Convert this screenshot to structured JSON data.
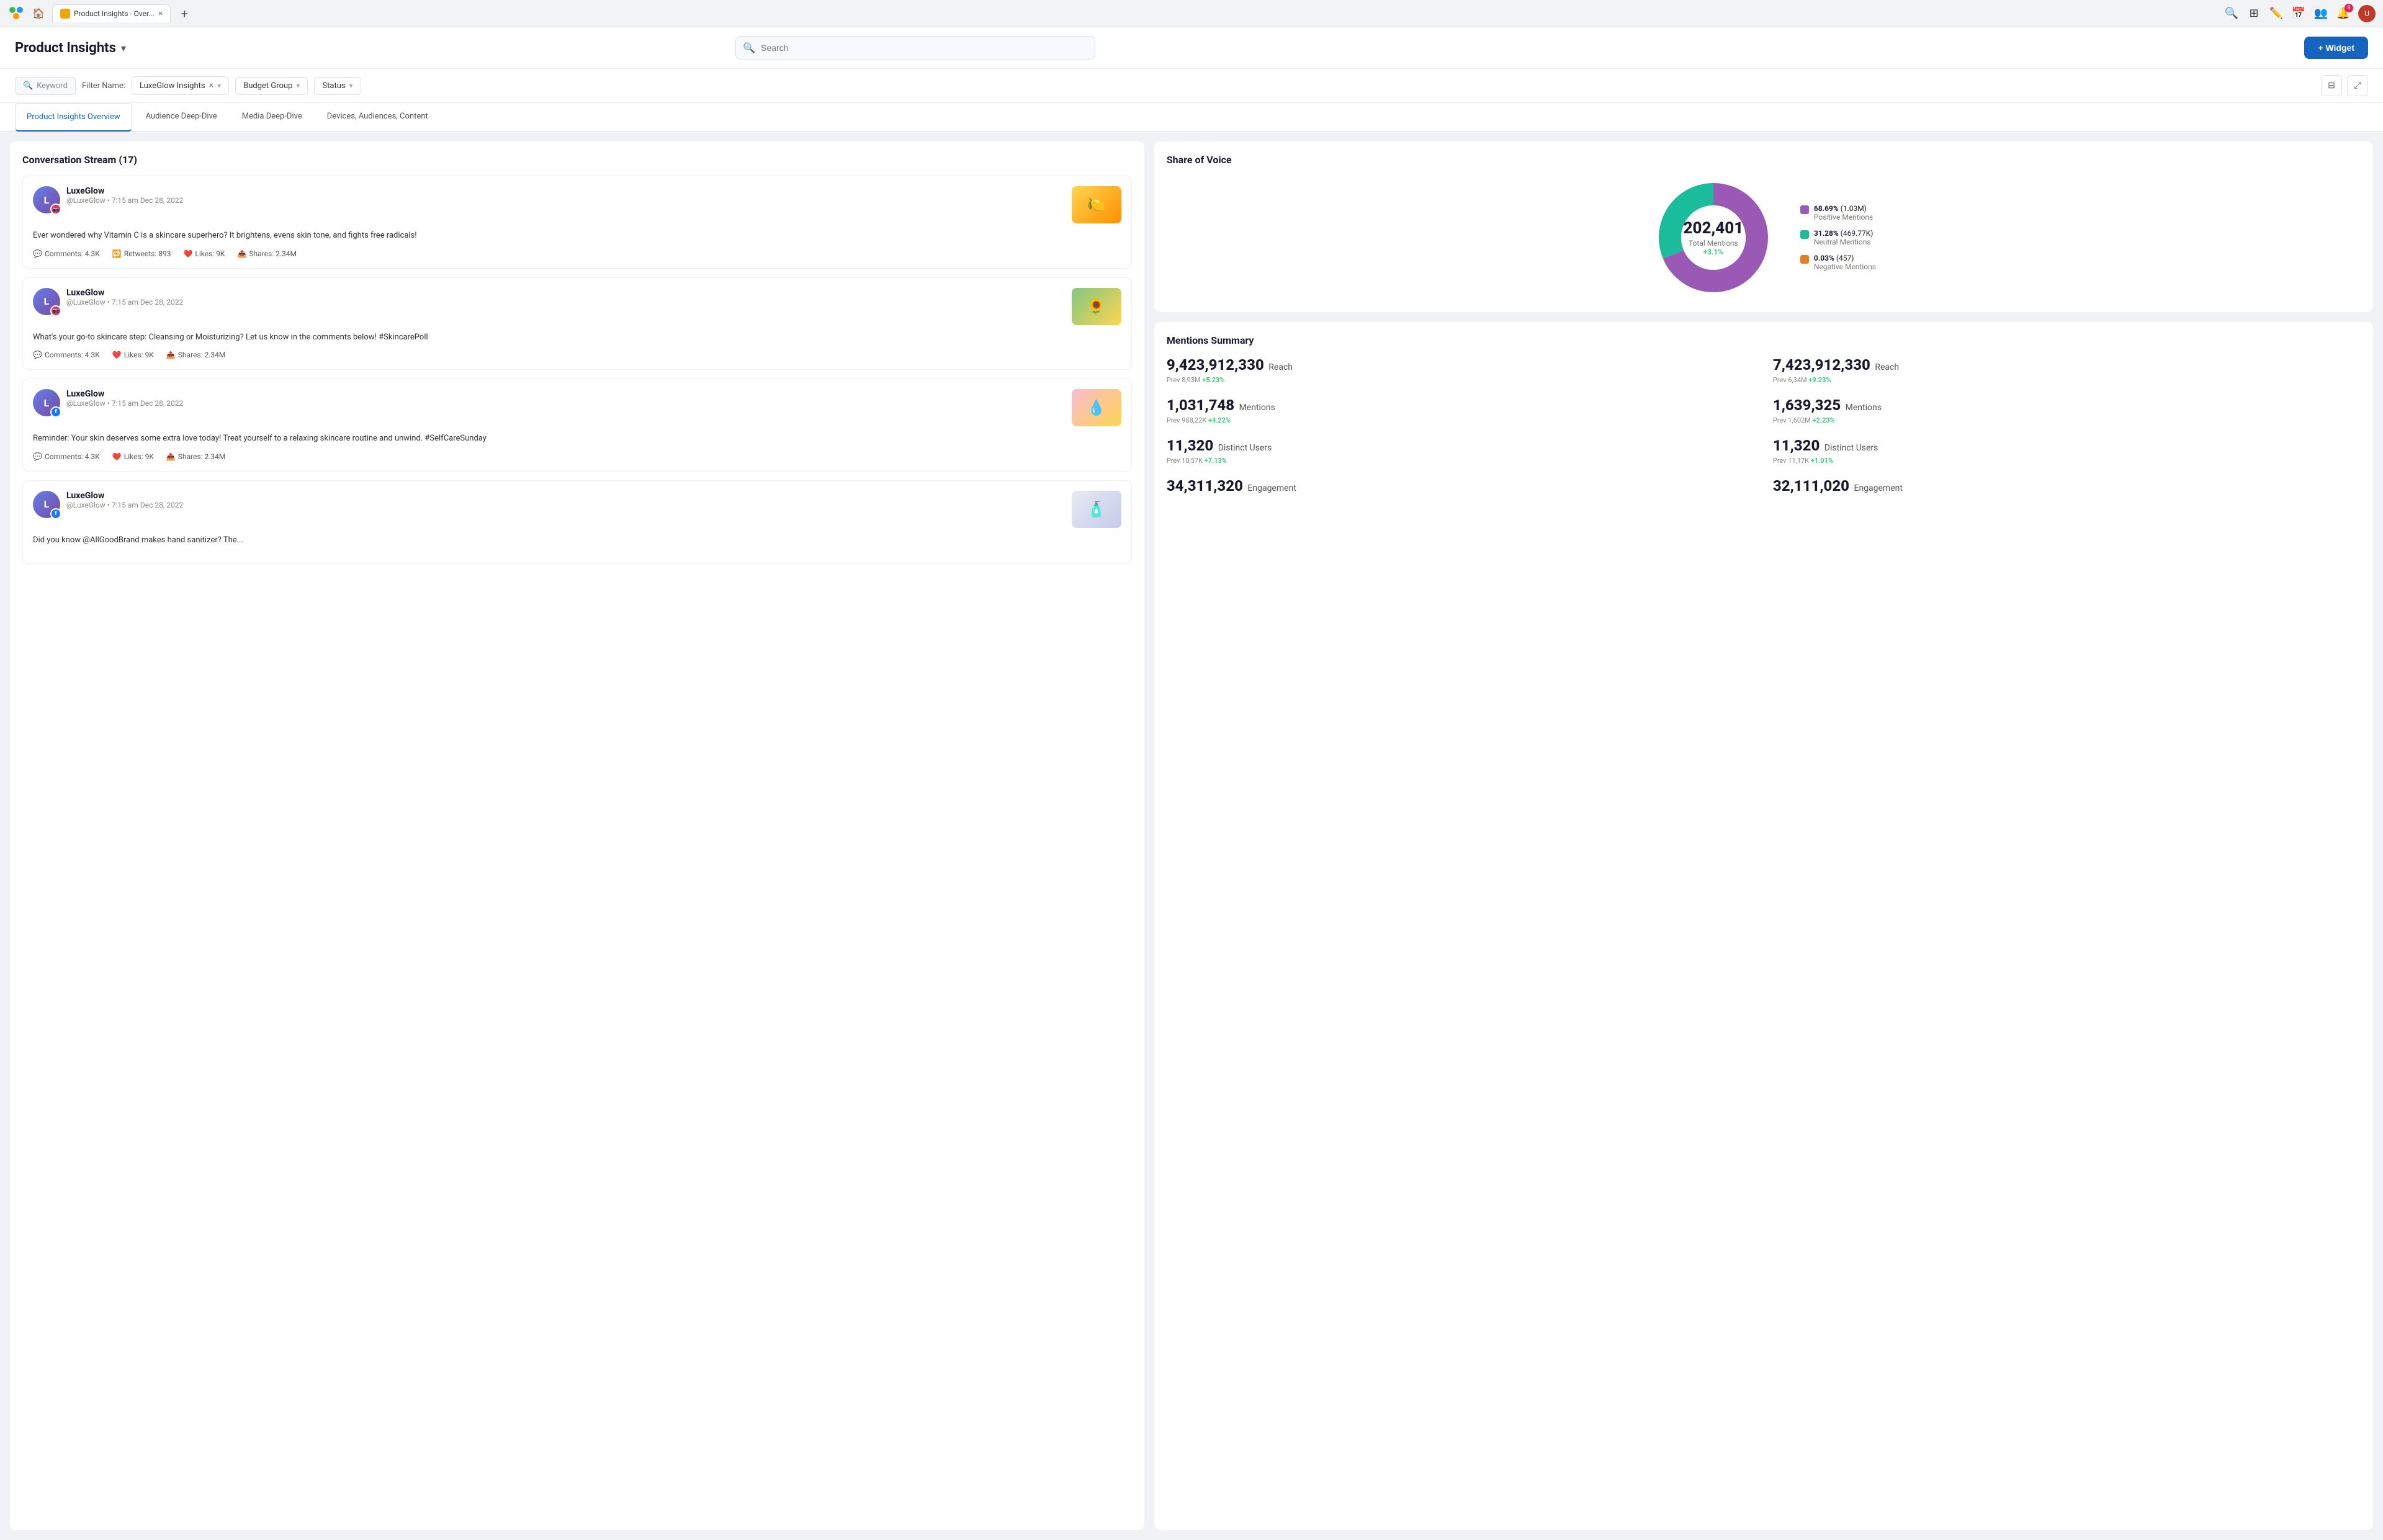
{
  "browser": {
    "tab_title": "Product Insights - Over...",
    "tab_close": "×",
    "tab_add": "+",
    "icons": [
      "search",
      "grid",
      "edit",
      "calendar",
      "users",
      "bell",
      "avatar"
    ],
    "bell_badge": "8",
    "users_badge": ""
  },
  "header": {
    "page_title": "Product Insights",
    "chevron": "▾",
    "search_placeholder": "Search",
    "widget_button": "+ Widget"
  },
  "filter_bar": {
    "keyword_placeholder": "Keyword",
    "filter_name_label": "Filter Name:",
    "filter_tag": "LuxeGlow Insights",
    "filter_tag_close": "×",
    "budget_group_label": "Budget Group",
    "status_label": "Status"
  },
  "tabs": [
    {
      "id": "overview",
      "label": "Product Insights Overview",
      "active": true
    },
    {
      "id": "audience",
      "label": "Audience Deep-Dive",
      "active": false
    },
    {
      "id": "media",
      "label": "Media Deep-Dive",
      "active": false
    },
    {
      "id": "devices",
      "label": "Devices, Audiences, Content",
      "active": false
    }
  ],
  "conversation_stream": {
    "title": "Conversation Stream (17)",
    "posts": [
      {
        "username": "LuxeGlow",
        "handle": "@LuxeGlow",
        "timestamp": "7:15 am Dec 28, 2022",
        "social": "instagram",
        "text": "Ever wondered why Vitamin C is a skincare superhero? It brightens, evens skin tone, and fights free radicals!",
        "thumb_emoji": "🍋",
        "thumb_type": "lemon",
        "comments": "Comments: 4.3K",
        "retweets": "Retweets: 893",
        "likes": "Likes: 9K",
        "shares": "Shares: 2.34M"
      },
      {
        "username": "LuxeGlow",
        "handle": "@LuxeGlow",
        "timestamp": "7:15 am Dec 28, 2022",
        "social": "instagram",
        "text": "What's your go-to skincare step: Cleansing or Moisturizing? Let us know in the comments below! #SkincarePoll",
        "thumb_emoji": "🌻",
        "thumb_type": "girls",
        "comments": "Comments: 4.3K",
        "likes": "Likes: 9K",
        "shares": "Shares: 2.34M"
      },
      {
        "username": "LuxeGlow",
        "handle": "@LuxeGlow",
        "timestamp": "7:15 am Dec 28, 2022",
        "social": "facebook",
        "text": "Reminder: Your skin deserves some extra love today! Treat yourself to a relaxing skincare routine and unwind. #SelfCareSunday",
        "thumb_emoji": "💧",
        "thumb_type": "serum",
        "comments": "Comments: 4.3K",
        "likes": "Likes: 9K",
        "shares": "Shares: 2.34M"
      },
      {
        "username": "LuxeGlow",
        "handle": "@LuxeGlow",
        "timestamp": "7:15 am Dec 28, 2022",
        "social": "facebook",
        "text": "Did you know @AllGoodBrand makes hand sanitizer? The...",
        "thumb_emoji": "🧴",
        "thumb_type": "cream",
        "comments": "Comments: 4.3K",
        "likes": "Likes: 9K",
        "shares": "Shares: 2.34M"
      }
    ]
  },
  "share_of_voice": {
    "title": "Share of Voice",
    "total": "202,401",
    "total_label": "Total Mentions",
    "change": "+3.1%",
    "segments": [
      {
        "label": "Positive Mentions",
        "pct": "68.69%",
        "count": "1.03M",
        "color": "#9b59b6"
      },
      {
        "label": "Neutral Mentions",
        "pct": "31.28%",
        "count": "469.77K",
        "color": "#1abc9c"
      },
      {
        "label": "Negative Mentions",
        "pct": "0.03%",
        "count": "457",
        "color": "#e67e22"
      }
    ],
    "donut": {
      "positive_pct": 68.69,
      "neutral_pct": 31.28,
      "negative_pct": 0.03
    }
  },
  "mentions_summary": {
    "title": "Mentions Summary",
    "metrics": [
      {
        "value": "9,423,912,330",
        "unit": "Reach",
        "prev": "Prev 8,93M",
        "change": "+5.23%"
      },
      {
        "value": "7,423,912,330",
        "unit": "Reach",
        "prev": "Prev 6,34M",
        "change": "+9.23%"
      },
      {
        "value": "1,031,748",
        "unit": "Mentions",
        "prev": "Prev 988,22K",
        "change": "+4.22%"
      },
      {
        "value": "1,639,325",
        "unit": "Mentions",
        "prev": "Prev 1,602M",
        "change": "+2.23%"
      },
      {
        "value": "11,320",
        "unit": "Distinct Users",
        "prev": "Prev 10,57K",
        "change": "+7.13%"
      },
      {
        "value": "11,320",
        "unit": "Distinct Users",
        "prev": "Prev 11,17K",
        "change": "+1.01%"
      },
      {
        "value": "34,311,320",
        "unit": "Engagement",
        "prev": "",
        "change": ""
      },
      {
        "value": "32,111,020",
        "unit": "Engagement",
        "prev": "",
        "change": ""
      }
    ]
  }
}
